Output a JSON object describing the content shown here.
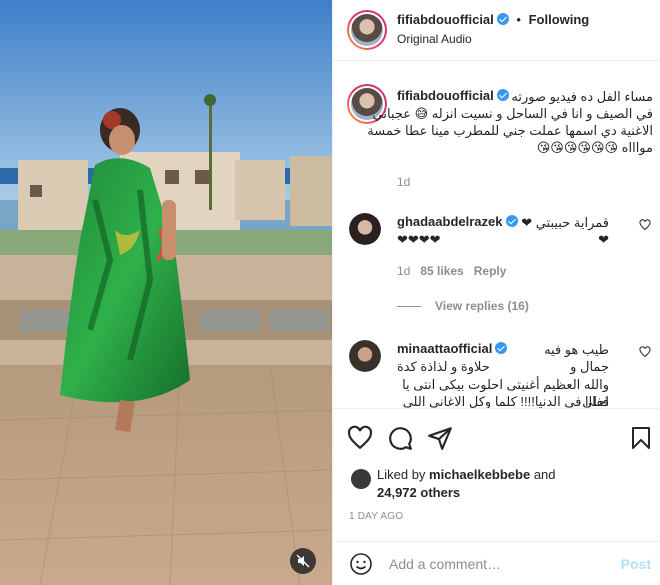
{
  "header": {
    "username": "fifiabdouofficial",
    "separator": "•",
    "follow_state": "Following",
    "audio": "Original Audio"
  },
  "caption": {
    "username": "fifiabdouofficial",
    "text_line1": "مساء الفل ده فيديو صورته",
    "text_line2": "في الصيف و انا في الساحل و نسيت انزله 😅 عجباني",
    "text_line3": "الاغنية دي اسمها عملت جني للمطرب مينا عطا خمسة",
    "text_line4": "مواااه 😘😘😘😘😘😘",
    "time": "1d"
  },
  "comments": [
    {
      "username": "ghadaabdelrazek",
      "text_line1": "قمراية حبيبتي ❤❤",
      "text_line2": "❤❤❤❤",
      "time": "1d",
      "likes": "85 likes",
      "reply": "Reply",
      "view_replies": "View replies (16)"
    },
    {
      "username": "minaattaofficial",
      "text_line1": "طيب هو فيه جمال و",
      "text_line2": "حلاوة و لذاذة كدة",
      "text_line3": "والله العظيم أغنيتى احلوت بيكى انتى يا احلى",
      "text_line4": "ففااا فى الدنيا!!!! كلما وكل الاغانى اللى جاية"
    }
  ],
  "actions": {
    "icons": [
      "heart-icon",
      "comment-icon",
      "share-icon",
      "bookmark-icon"
    ],
    "liked_prefix": "Liked by",
    "liked_user": "michaelkebbebe",
    "liked_and": "and",
    "liked_count": "24,972 others",
    "date": "1 DAY AGO"
  },
  "add_comment": {
    "placeholder": "Add a comment…",
    "post_label": "Post"
  },
  "colors": {
    "verified": "#3897f0",
    "post_disabled": "#b2dffc",
    "muted_text": "#8e8e8e"
  }
}
